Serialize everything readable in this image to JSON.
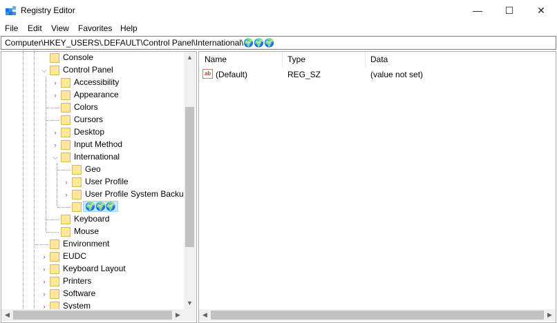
{
  "window": {
    "title": "Registry Editor",
    "controls": {
      "minimize": "—",
      "maximize": "☐",
      "close": "✕"
    }
  },
  "menu": [
    "File",
    "Edit",
    "View",
    "Favorites",
    "Help"
  ],
  "address": "Computer\\HKEY_USERS\\.DEFAULT\\Control Panel\\International\\🌍🌍🌍",
  "tree": {
    "items": [
      {
        "label": "Console",
        "expander": ""
      },
      {
        "label": "Control Panel",
        "expander": "⌵"
      },
      {
        "label": "Accessibility",
        "expander": "›"
      },
      {
        "label": "Appearance",
        "expander": "›"
      },
      {
        "label": "Colors",
        "expander": ""
      },
      {
        "label": "Cursors",
        "expander": ""
      },
      {
        "label": "Desktop",
        "expander": "›"
      },
      {
        "label": "Input Method",
        "expander": "›"
      },
      {
        "label": "International",
        "expander": "⌵"
      },
      {
        "label": "Geo",
        "expander": ""
      },
      {
        "label": "User Profile",
        "expander": "›"
      },
      {
        "label": "User Profile System Backup",
        "expander": "›"
      },
      {
        "label": "🌍🌍🌍",
        "expander": "",
        "selected": true
      },
      {
        "label": "Keyboard",
        "expander": ""
      },
      {
        "label": "Mouse",
        "expander": ""
      },
      {
        "label": "Environment",
        "expander": ""
      },
      {
        "label": "EUDC",
        "expander": "›"
      },
      {
        "label": "Keyboard Layout",
        "expander": "›"
      },
      {
        "label": "Printers",
        "expander": "›"
      },
      {
        "label": "Software",
        "expander": "›"
      },
      {
        "label": "System",
        "expander": "›"
      }
    ]
  },
  "list": {
    "columns": [
      "Name",
      "Type",
      "Data"
    ],
    "rows": [
      {
        "icon": "string-value-icon",
        "icon_text": "ab",
        "name": "(Default)",
        "type": "REG_SZ",
        "data": "(value not set)"
      }
    ]
  },
  "scroll": {
    "up": "▲",
    "down": "▼",
    "left": "◀",
    "right": "▶"
  }
}
